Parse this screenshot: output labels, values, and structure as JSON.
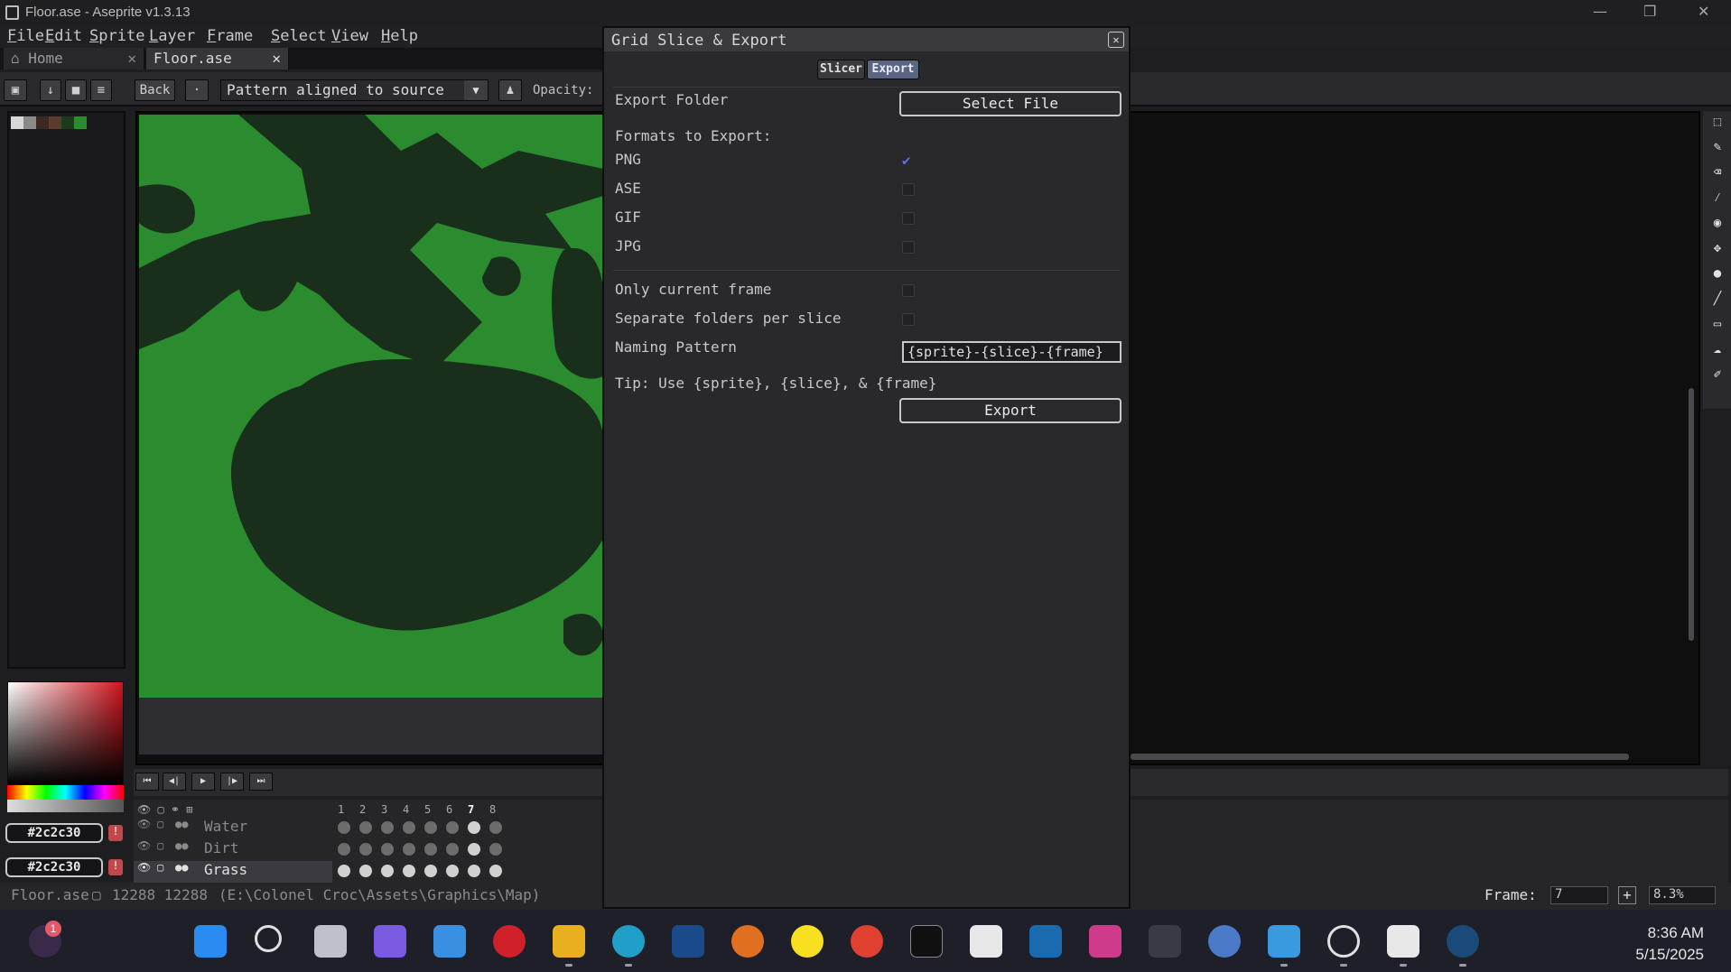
{
  "window": {
    "title": "Floor.ase - Aseprite v1.3.13"
  },
  "menu": [
    "File",
    "Edit",
    "Sprite",
    "Layer",
    "Frame",
    "Select",
    "View",
    "Help"
  ],
  "tabs": [
    {
      "label": "Home",
      "icon": "home-icon"
    },
    {
      "label": "Floor.ase"
    }
  ],
  "toolbar": {
    "back_label": "Back",
    "pattern_value": "Pattern aligned to source",
    "opacity_label": "Opacity:"
  },
  "colors": {
    "fg_hex": "#2c2c30",
    "bg_hex": "#2c2c30",
    "canvas_green": "#2a8c2e",
    "canvas_dark": "#1a2e1c",
    "accent_check": "#5b6ee8"
  },
  "timeline": {
    "frames": [
      "1",
      "2",
      "3",
      "4",
      "5",
      "6",
      "7",
      "8"
    ],
    "current_frame_index": 6,
    "layers": [
      {
        "name": "Water"
      },
      {
        "name": "Dirt"
      },
      {
        "name": "Grass"
      }
    ]
  },
  "status": {
    "file": "Floor.ase",
    "size": "12288 12288",
    "path": "(E:\\Colonel Croc\\Assets\\Graphics\\Map)",
    "frame_label": "Frame:",
    "frame_value": "7",
    "zoom": "8.3%"
  },
  "dialog": {
    "title": "Grid Slice & Export",
    "tabs": [
      "Slicer",
      "Export"
    ],
    "active_tab": "Export",
    "export_folder_label": "Export Folder",
    "select_file_label": "Select File",
    "formats_label": "Formats to Export:",
    "formats": [
      {
        "name": "PNG",
        "checked": true
      },
      {
        "name": "ASE",
        "checked": false
      },
      {
        "name": "GIF",
        "checked": false
      },
      {
        "name": "JPG",
        "checked": false
      }
    ],
    "only_current_frame_label": "Only current frame",
    "separate_folders_label": "Separate folders per slice",
    "naming_pattern_label": "Naming Pattern",
    "naming_pattern_value": "{sprite}-{slice}-{frame}",
    "tip": "Tip: Use {sprite}, {slice}, & {frame}",
    "export_label": "Export"
  },
  "taskbar": {
    "notification_count": "1",
    "time": "8:36 AM",
    "date": "5/15/2025"
  }
}
